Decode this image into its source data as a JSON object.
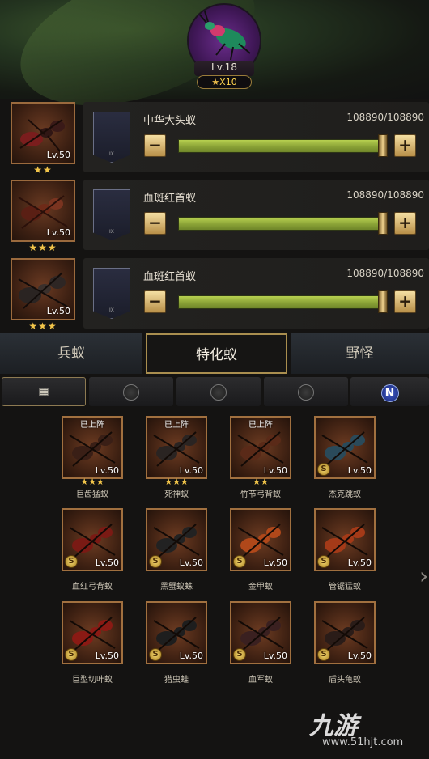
{
  "header": {
    "level_label": "Lv.18",
    "star_label": "X10",
    "star_glyph": "★"
  },
  "team": [
    {
      "name": "中华大头蚁",
      "count": "108890/108890",
      "level": "Lv.50",
      "stars": "★★"
    },
    {
      "name": "血斑红首蚁",
      "count": "108890/108890",
      "level": "Lv.50",
      "stars": "★★★"
    },
    {
      "name": "血斑红首蚁",
      "count": "108890/108890",
      "level": "Lv.50",
      "stars": "★★★"
    }
  ],
  "card_tier": "IX",
  "minus_label": "−",
  "plus_label": "+",
  "tabs": [
    "兵蚁",
    "特化蚁",
    "野怪"
  ],
  "active_tab": "特化蚁",
  "subtabs": {
    "all_icon": "grid-icon",
    "icons": [
      "ant-type-1-icon",
      "ant-type-2-icon",
      "ant-type-3-icon",
      "n-icon"
    ],
    "n_label": "N"
  },
  "units": [
    {
      "name": "巨齿猛蚁",
      "level": "Lv.50",
      "deployed": "已上阵",
      "stars": "★★★"
    },
    {
      "name": "死神蚁",
      "level": "Lv.50",
      "deployed": "已上阵",
      "stars": "★★★"
    },
    {
      "name": "竹节弓背蚁",
      "level": "Lv.50",
      "deployed": "已上阵",
      "stars": "★★"
    },
    {
      "name": "杰克跳蚁",
      "level": "Lv.50",
      "deployed": "",
      "stars": ""
    },
    {
      "name": "血红弓背蚁",
      "level": "Lv.50",
      "deployed": "",
      "stars": ""
    },
    {
      "name": "黑蟹蚁蛛",
      "level": "Lv.50",
      "deployed": "",
      "stars": ""
    },
    {
      "name": "金甲蚁",
      "level": "Lv.50",
      "deployed": "",
      "stars": ""
    },
    {
      "name": "管锯猛蚁",
      "level": "Lv.50",
      "deployed": "",
      "stars": ""
    },
    {
      "name": "巨型切叶蚁",
      "level": "Lv.50",
      "deployed": "",
      "stars": ""
    },
    {
      "name": "猎虫蛙",
      "level": "Lv.50",
      "deployed": "",
      "stars": ""
    },
    {
      "name": "血军蚁",
      "level": "Lv.50",
      "deployed": "",
      "stars": ""
    },
    {
      "name": "盾头龟蚁",
      "level": "Lv.50",
      "deployed": "",
      "stars": ""
    }
  ],
  "coin_glyph": "S",
  "next_arrow": "›",
  "watermark": {
    "logo": "九游",
    "url": "www.51hjt.com"
  },
  "colors": {
    "accent_gold": "#a98e4f",
    "bar_green": "#a4be45",
    "star_yellow": "#f2c54a"
  }
}
